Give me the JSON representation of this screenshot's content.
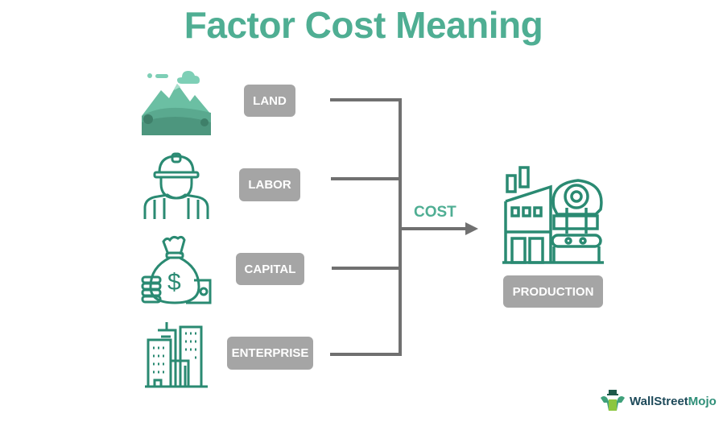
{
  "title": "Factor Cost Meaning",
  "factors": [
    {
      "label": "LAND",
      "icon": "mountain-icon"
    },
    {
      "label": "LABOR",
      "icon": "worker-icon"
    },
    {
      "label": "CAPITAL",
      "icon": "money-bag-icon"
    },
    {
      "label": "ENTERPRISE",
      "icon": "buildings-icon"
    }
  ],
  "connector_label": "COST",
  "output": {
    "label": "PRODUCTION",
    "icon": "factory-icon"
  },
  "brand": {
    "name_part1": "WallStreet",
    "name_part2": "Mojo"
  },
  "colors": {
    "accent": "#4fae93",
    "icon_stroke": "#2a8a72",
    "pill": "#a5a5a5",
    "line": "#707070"
  }
}
